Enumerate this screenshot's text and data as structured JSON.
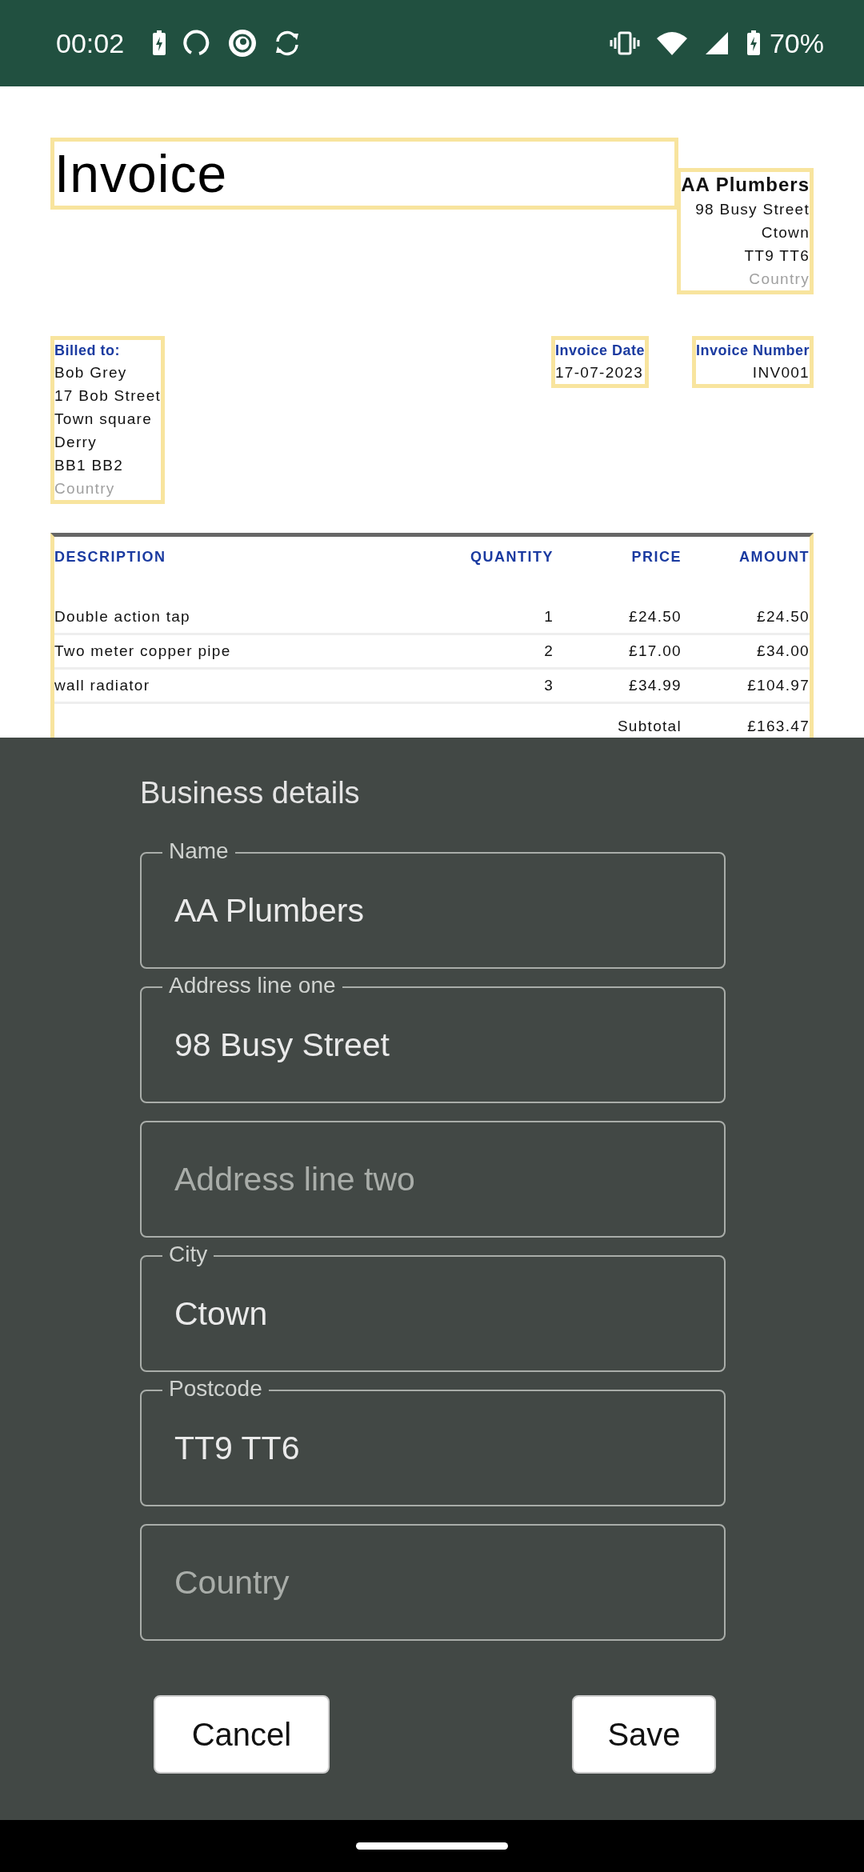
{
  "status_bar": {
    "time": "00:02",
    "battery": "70%"
  },
  "invoice": {
    "title": "Invoice",
    "business": {
      "name": "AA Plumbers",
      "lines": [
        {
          "text": "98 Busy Street",
          "muted": false
        },
        {
          "text": "Ctown",
          "muted": false
        },
        {
          "text": "TT9 TT6",
          "muted": false
        },
        {
          "text": "Country",
          "muted": true
        }
      ]
    },
    "billed_to": {
      "label": "Billed to:",
      "lines": [
        {
          "text": "Bob Grey",
          "muted": false
        },
        {
          "text": "17 Bob Street",
          "muted": false
        },
        {
          "text": "Town square",
          "muted": false
        },
        {
          "text": "Derry",
          "muted": false
        },
        {
          "text": "BB1 BB2",
          "muted": false
        },
        {
          "text": "Country",
          "muted": true
        }
      ]
    },
    "invoice_date": {
      "label": "Invoice Date",
      "value": "17-07-2023"
    },
    "invoice_number": {
      "label": "Invoice Number",
      "value": "INV001"
    },
    "table": {
      "columns": [
        "DESCRIPTION",
        "QUANTITY",
        "PRICE",
        "AMOUNT"
      ],
      "rows": [
        {
          "cells": [
            "Double action tap",
            "1",
            "£24.50",
            "£24.50"
          ]
        },
        {
          "cells": [
            "Two meter copper pipe",
            "2",
            "£17.00",
            "£34.00"
          ]
        },
        {
          "cells": [
            "wall radiator",
            "3",
            "£34.99",
            "£104.97"
          ]
        }
      ],
      "subtotal": {
        "label": "Subtotal",
        "value": "£163.47"
      }
    }
  },
  "dialog": {
    "title": "Business details",
    "fields": [
      {
        "label": "Name",
        "value": "AA Plumbers"
      },
      {
        "label": "Address line one",
        "value": "98 Busy Street"
      },
      {
        "placeholder": "Address line two"
      },
      {
        "label": "City",
        "value": "Ctown"
      },
      {
        "label": "Postcode",
        "value": "TT9 TT6"
      },
      {
        "placeholder": "Country"
      }
    ],
    "buttons": [
      "Cancel",
      "Save"
    ]
  }
}
